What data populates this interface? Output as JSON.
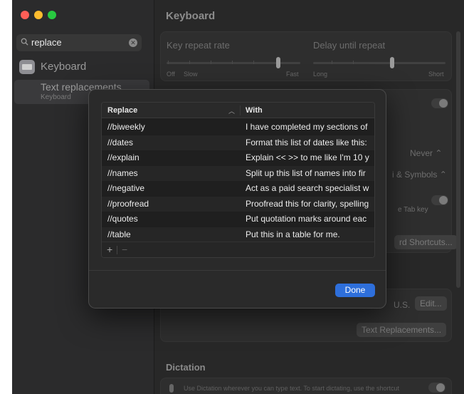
{
  "sidebar": {
    "search": {
      "value": "replace"
    },
    "item_keyboard": "Keyboard",
    "sub_title": "Text replacements",
    "sub_caption": "Keyboard"
  },
  "main": {
    "title": "Keyboard",
    "key_repeat_rate": "Key repeat rate",
    "delay_until_repeat": "Delay until repeat",
    "rate_off": "Off",
    "rate_slow": "Slow",
    "rate_fast": "Fast",
    "delay_long": "Long",
    "delay_short": "Short",
    "never_value": "Never",
    "input_menu_fragment": "i & Symbols",
    "tab_hint_fragment": "e Tab key",
    "shortcuts_btn_fragment": "rd Shortcuts...",
    "input_source_fragment": "U.S.",
    "edit_btn": "Edit...",
    "text_replacements_btn": "Text Replacements...",
    "dictation_title": "Dictation",
    "dictation_text": "Use Dictation wherever you can type text. To start dictating, use the shortcut"
  },
  "dialog": {
    "headers": {
      "replace": "Replace",
      "with": "With"
    },
    "rows": [
      {
        "replace": "//biweekly",
        "with": "I have completed my sections of"
      },
      {
        "replace": "//dates",
        "with": "Format this list of dates like this:"
      },
      {
        "replace": "//explain",
        "with": "Explain << >> to me like I'm 10 y"
      },
      {
        "replace": "//names",
        "with": "Split up this list of names into fir"
      },
      {
        "replace": "//negative",
        "with": "Act as a paid search specialist w"
      },
      {
        "replace": "//proofread",
        "with": "Proofread this for clarity, spelling"
      },
      {
        "replace": "//quotes",
        "with": "Put quotation marks around eac"
      },
      {
        "replace": "//table",
        "with": "Put this in a table for me."
      }
    ],
    "add_label": "+",
    "remove_label": "−",
    "done_label": "Done"
  }
}
